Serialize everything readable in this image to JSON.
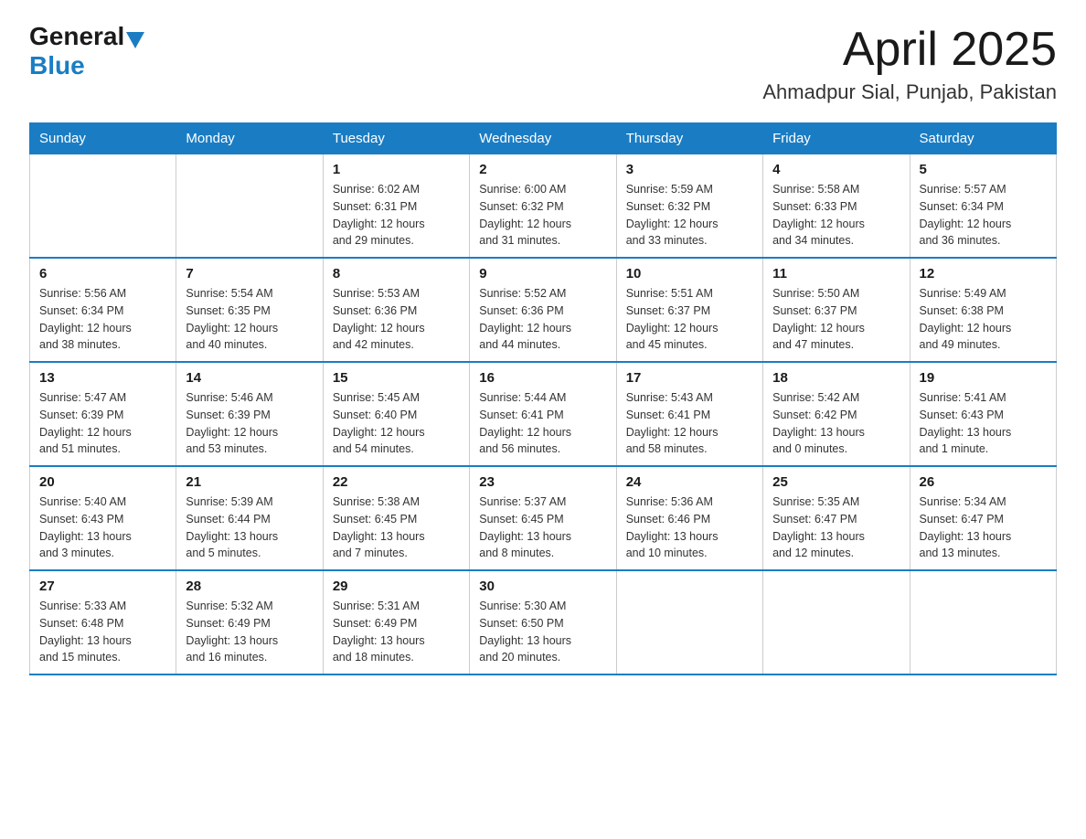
{
  "header": {
    "logo_general": "General",
    "logo_blue": "Blue",
    "title": "April 2025",
    "subtitle": "Ahmadpur Sial, Punjab, Pakistan"
  },
  "calendar": {
    "days_of_week": [
      "Sunday",
      "Monday",
      "Tuesday",
      "Wednesday",
      "Thursday",
      "Friday",
      "Saturday"
    ],
    "weeks": [
      [
        {
          "day": "",
          "info": ""
        },
        {
          "day": "",
          "info": ""
        },
        {
          "day": "1",
          "info": "Sunrise: 6:02 AM\nSunset: 6:31 PM\nDaylight: 12 hours\nand 29 minutes."
        },
        {
          "day": "2",
          "info": "Sunrise: 6:00 AM\nSunset: 6:32 PM\nDaylight: 12 hours\nand 31 minutes."
        },
        {
          "day": "3",
          "info": "Sunrise: 5:59 AM\nSunset: 6:32 PM\nDaylight: 12 hours\nand 33 minutes."
        },
        {
          "day": "4",
          "info": "Sunrise: 5:58 AM\nSunset: 6:33 PM\nDaylight: 12 hours\nand 34 minutes."
        },
        {
          "day": "5",
          "info": "Sunrise: 5:57 AM\nSunset: 6:34 PM\nDaylight: 12 hours\nand 36 minutes."
        }
      ],
      [
        {
          "day": "6",
          "info": "Sunrise: 5:56 AM\nSunset: 6:34 PM\nDaylight: 12 hours\nand 38 minutes."
        },
        {
          "day": "7",
          "info": "Sunrise: 5:54 AM\nSunset: 6:35 PM\nDaylight: 12 hours\nand 40 minutes."
        },
        {
          "day": "8",
          "info": "Sunrise: 5:53 AM\nSunset: 6:36 PM\nDaylight: 12 hours\nand 42 minutes."
        },
        {
          "day": "9",
          "info": "Sunrise: 5:52 AM\nSunset: 6:36 PM\nDaylight: 12 hours\nand 44 minutes."
        },
        {
          "day": "10",
          "info": "Sunrise: 5:51 AM\nSunset: 6:37 PM\nDaylight: 12 hours\nand 45 minutes."
        },
        {
          "day": "11",
          "info": "Sunrise: 5:50 AM\nSunset: 6:37 PM\nDaylight: 12 hours\nand 47 minutes."
        },
        {
          "day": "12",
          "info": "Sunrise: 5:49 AM\nSunset: 6:38 PM\nDaylight: 12 hours\nand 49 minutes."
        }
      ],
      [
        {
          "day": "13",
          "info": "Sunrise: 5:47 AM\nSunset: 6:39 PM\nDaylight: 12 hours\nand 51 minutes."
        },
        {
          "day": "14",
          "info": "Sunrise: 5:46 AM\nSunset: 6:39 PM\nDaylight: 12 hours\nand 53 minutes."
        },
        {
          "day": "15",
          "info": "Sunrise: 5:45 AM\nSunset: 6:40 PM\nDaylight: 12 hours\nand 54 minutes."
        },
        {
          "day": "16",
          "info": "Sunrise: 5:44 AM\nSunset: 6:41 PM\nDaylight: 12 hours\nand 56 minutes."
        },
        {
          "day": "17",
          "info": "Sunrise: 5:43 AM\nSunset: 6:41 PM\nDaylight: 12 hours\nand 58 minutes."
        },
        {
          "day": "18",
          "info": "Sunrise: 5:42 AM\nSunset: 6:42 PM\nDaylight: 13 hours\nand 0 minutes."
        },
        {
          "day": "19",
          "info": "Sunrise: 5:41 AM\nSunset: 6:43 PM\nDaylight: 13 hours\nand 1 minute."
        }
      ],
      [
        {
          "day": "20",
          "info": "Sunrise: 5:40 AM\nSunset: 6:43 PM\nDaylight: 13 hours\nand 3 minutes."
        },
        {
          "day": "21",
          "info": "Sunrise: 5:39 AM\nSunset: 6:44 PM\nDaylight: 13 hours\nand 5 minutes."
        },
        {
          "day": "22",
          "info": "Sunrise: 5:38 AM\nSunset: 6:45 PM\nDaylight: 13 hours\nand 7 minutes."
        },
        {
          "day": "23",
          "info": "Sunrise: 5:37 AM\nSunset: 6:45 PM\nDaylight: 13 hours\nand 8 minutes."
        },
        {
          "day": "24",
          "info": "Sunrise: 5:36 AM\nSunset: 6:46 PM\nDaylight: 13 hours\nand 10 minutes."
        },
        {
          "day": "25",
          "info": "Sunrise: 5:35 AM\nSunset: 6:47 PM\nDaylight: 13 hours\nand 12 minutes."
        },
        {
          "day": "26",
          "info": "Sunrise: 5:34 AM\nSunset: 6:47 PM\nDaylight: 13 hours\nand 13 minutes."
        }
      ],
      [
        {
          "day": "27",
          "info": "Sunrise: 5:33 AM\nSunset: 6:48 PM\nDaylight: 13 hours\nand 15 minutes."
        },
        {
          "day": "28",
          "info": "Sunrise: 5:32 AM\nSunset: 6:49 PM\nDaylight: 13 hours\nand 16 minutes."
        },
        {
          "day": "29",
          "info": "Sunrise: 5:31 AM\nSunset: 6:49 PM\nDaylight: 13 hours\nand 18 minutes."
        },
        {
          "day": "30",
          "info": "Sunrise: 5:30 AM\nSunset: 6:50 PM\nDaylight: 13 hours\nand 20 minutes."
        },
        {
          "day": "",
          "info": ""
        },
        {
          "day": "",
          "info": ""
        },
        {
          "day": "",
          "info": ""
        }
      ]
    ]
  }
}
